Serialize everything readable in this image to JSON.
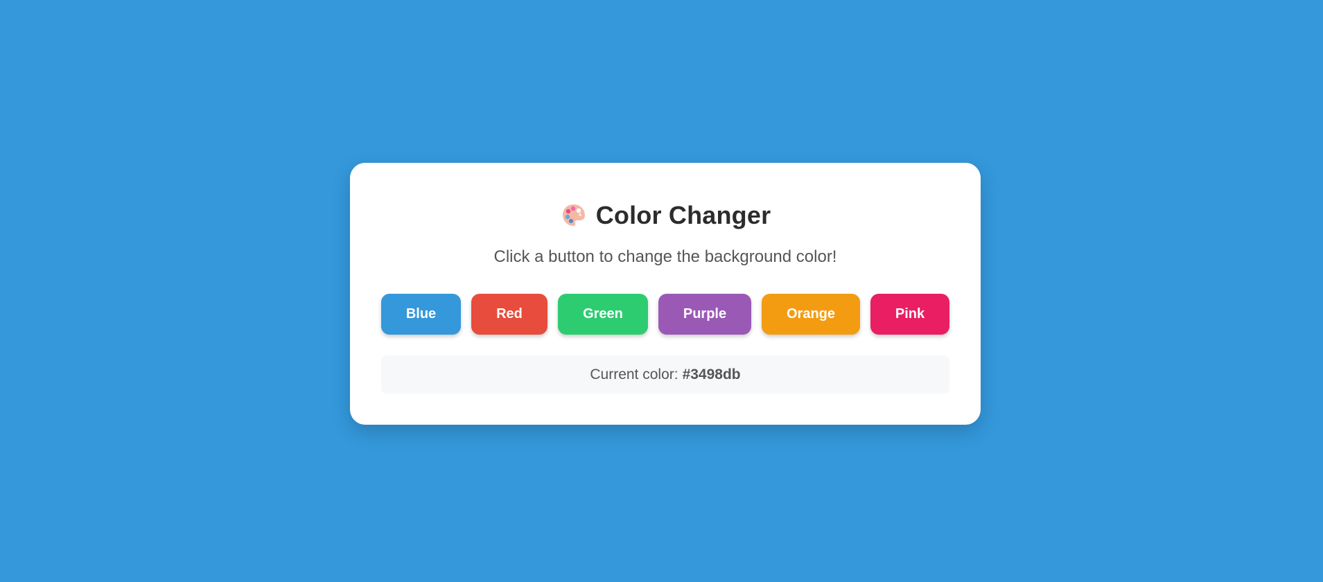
{
  "page": {
    "background_color": "#3498db"
  },
  "card": {
    "icon": "palette-icon",
    "title": "Color Changer",
    "subtitle": "Click a button to change the background color!"
  },
  "buttons": [
    {
      "label": "Blue",
      "color": "#3498db"
    },
    {
      "label": "Red",
      "color": "#e74c3c"
    },
    {
      "label": "Green",
      "color": "#2ecc71"
    },
    {
      "label": "Purple",
      "color": "#9b59b6"
    },
    {
      "label": "Orange",
      "color": "#f39c12"
    },
    {
      "label": "Pink",
      "color": "#e91e63"
    }
  ],
  "status": {
    "label": "Current color:",
    "value": "#3498db"
  }
}
